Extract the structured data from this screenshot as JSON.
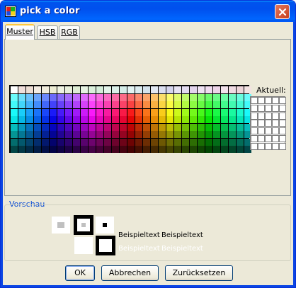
{
  "window": {
    "title": "pick a color"
  },
  "tabs": [
    {
      "label": "Muster",
      "active": true
    },
    {
      "label": "HSB",
      "active": false
    },
    {
      "label": "RGB",
      "active": false
    }
  ],
  "swatches": {
    "recent_label": "Aktuell:",
    "columns": 31,
    "rows": 9
  },
  "preview": {
    "legend": "Vorschau",
    "sample_text": "Beispieltext"
  },
  "buttons": {
    "ok": "OK",
    "cancel": "Abbrechen",
    "reset": "Zurücksetzen"
  },
  "colors": {
    "title_gradient": "#0053ee",
    "legend_blue": "#0046d5",
    "dialog_bg": "#ece9d8",
    "close_red": "#d9532f"
  },
  "icons": {
    "title": "color-swatch-icon",
    "close": "close-x-icon"
  }
}
